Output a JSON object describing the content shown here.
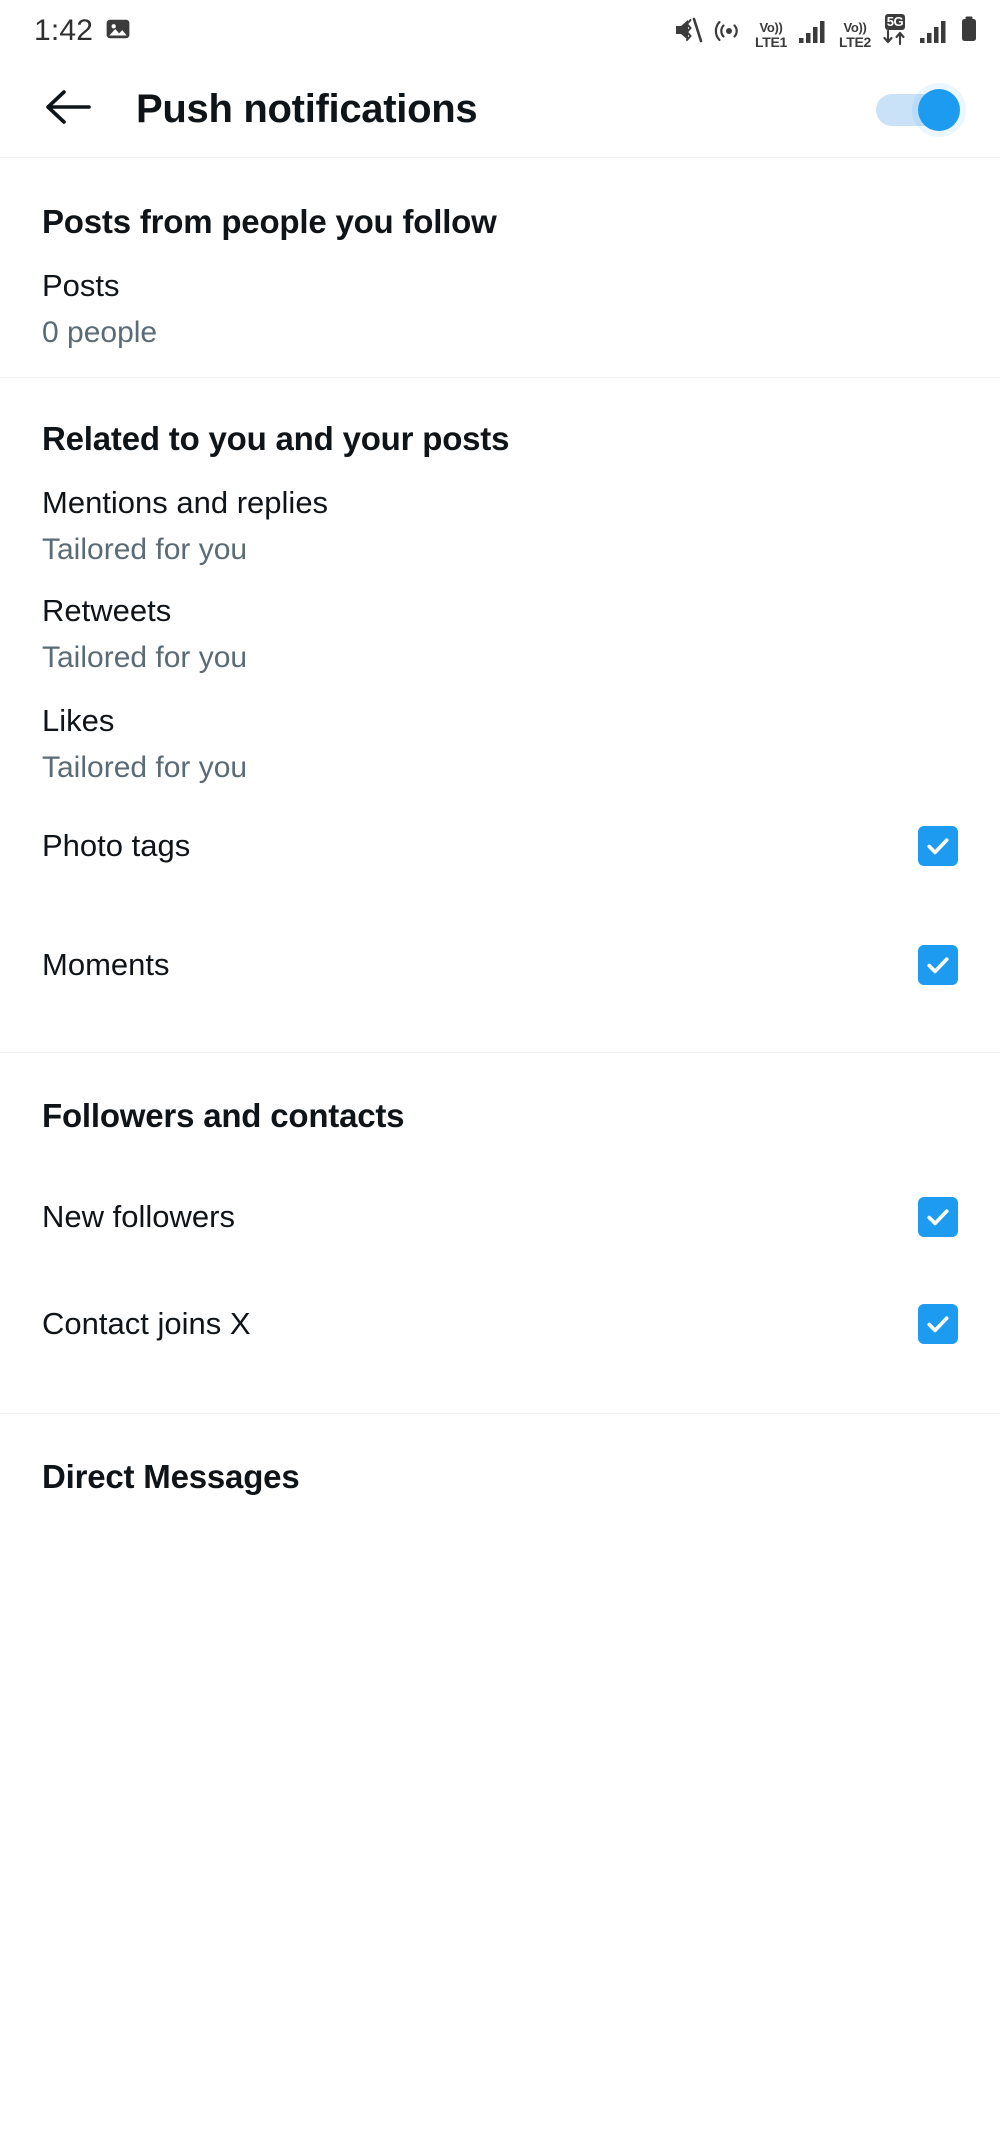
{
  "statusbar": {
    "clock": "1:42",
    "icons": [
      {
        "name": "screenshot-icon",
        "label": ""
      },
      {
        "name": "mute-vibrate-icon",
        "label": ""
      },
      {
        "name": "hotspot-icon",
        "label": ""
      },
      {
        "name": "volte1-icon",
        "label": "Vo))"
      },
      {
        "name": "signal-1-icon",
        "label": ""
      },
      {
        "name": "volte2-icon",
        "label": "Vo))"
      },
      {
        "name": "fiveg-data-icon",
        "label": "5G"
      },
      {
        "name": "signal-2-icon",
        "label": ""
      },
      {
        "name": "battery-icon",
        "label": ""
      }
    ],
    "volte1_top": "Vo))",
    "volte1_bottom": "LTE1",
    "volte2_top": "Vo))",
    "volte2_bottom": "LTE2",
    "fiveg_badge": "5G"
  },
  "appbar": {
    "back_label": "Back",
    "title": "Push notifications",
    "master_toggle_state": "on"
  },
  "colors": {
    "accent": "#1d9bf0",
    "toggle_track": "#c9e2f8",
    "text_primary": "#0f1419",
    "text_secondary": "#5b6b75",
    "divider": "#eff3f4"
  },
  "sections": [
    {
      "header": "Posts from people you follow",
      "rows": [
        {
          "title": "Posts",
          "subtitle": "0 people",
          "control": "none"
        }
      ]
    },
    {
      "header": "Related to you and your posts",
      "rows": [
        {
          "title": "Mentions and replies",
          "subtitle": "Tailored for you",
          "control": "none"
        },
        {
          "title": "Retweets",
          "subtitle": "Tailored for you",
          "control": "none"
        },
        {
          "title": "Likes",
          "subtitle": "Tailored for you",
          "control": "none"
        },
        {
          "title": "Photo tags",
          "subtitle": "",
          "control": "checkbox",
          "checked": true
        },
        {
          "title": "Moments",
          "subtitle": "",
          "control": "checkbox",
          "checked": true
        }
      ]
    },
    {
      "header": "Followers and contacts",
      "rows": [
        {
          "title": "New followers",
          "subtitle": "",
          "control": "checkbox",
          "checked": true
        },
        {
          "title": "Contact joins X",
          "subtitle": "",
          "control": "checkbox",
          "checked": true
        }
      ]
    },
    {
      "header": "Direct Messages",
      "rows": []
    }
  ]
}
